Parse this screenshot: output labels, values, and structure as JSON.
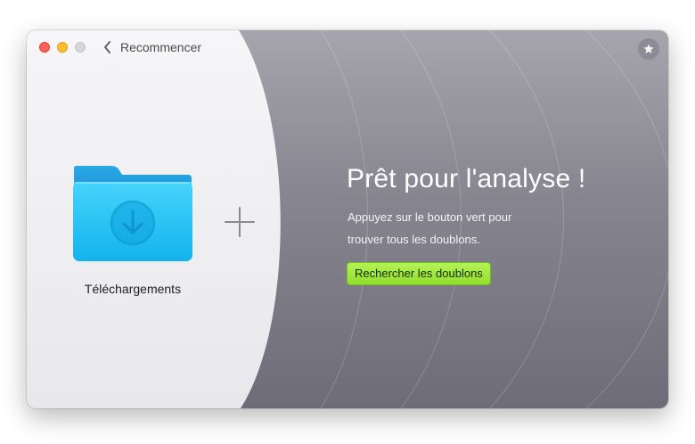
{
  "window": {
    "back_label": "Recommencer",
    "star_icon": "star-icon"
  },
  "source": {
    "folder_name": "Téléchargements",
    "folder_icon": "downloads-folder-icon",
    "add_icon": "plus-icon"
  },
  "main": {
    "headline": "Prêt pour l'analyse !",
    "subtitle_line1": "Appuyez sur le bouton vert pour",
    "subtitle_line2": "trouver tous les doublons.",
    "scan_button": "Rechercher les doublons"
  },
  "colors": {
    "accent_green": "#9be63b",
    "folder_blue": "#1fbcf4",
    "panel_light": "#f2f2f5",
    "panel_dark": "#7a7984"
  }
}
